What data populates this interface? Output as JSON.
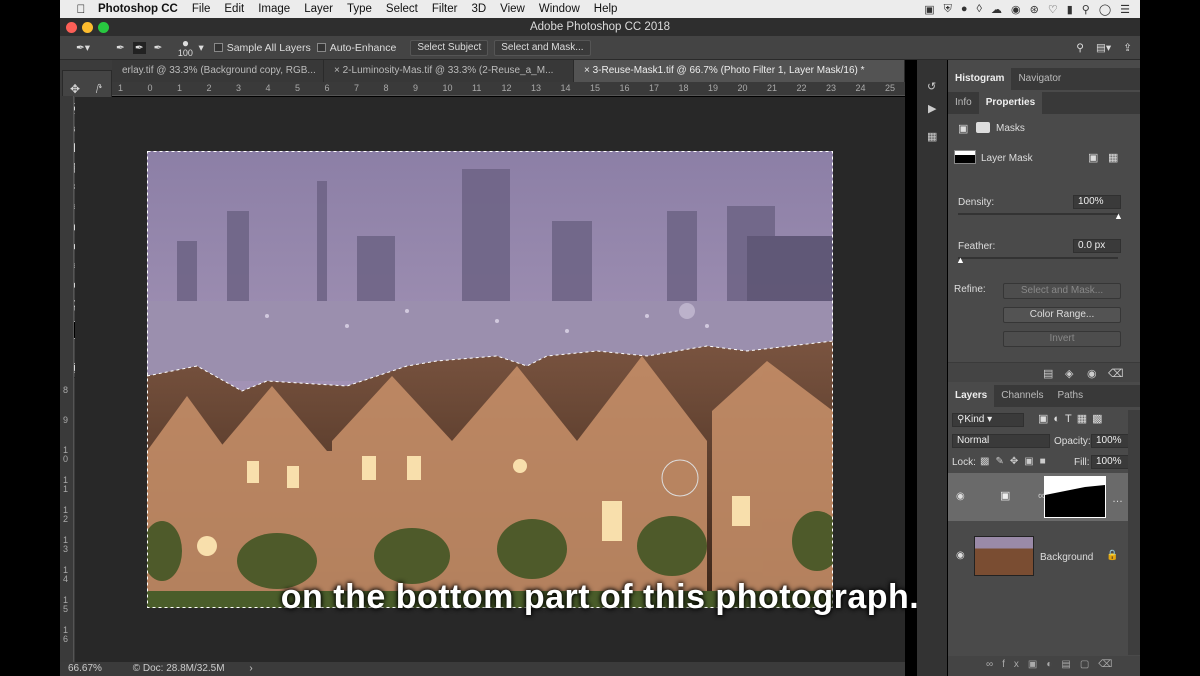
{
  "menubar": {
    "app": "Photoshop CC",
    "items": [
      "File",
      "Edit",
      "Image",
      "Layer",
      "Type",
      "Select",
      "Filter",
      "3D",
      "View",
      "Window",
      "Help"
    ]
  },
  "window": {
    "title": "Adobe Photoshop CC 2018"
  },
  "options": {
    "brush_size": "100",
    "sample_all_layers": "Sample All Layers",
    "auto_enhance": "Auto-Enhance",
    "select_subject": "Select Subject",
    "select_and_mask": "Select and Mask..."
  },
  "tabs": [
    {
      "label": "erlay.tif @ 33.3% (Background copy, RGB...",
      "close": "×"
    },
    {
      "label": "2-Luminosity-Mas.tif @ 33.3% (2-Reuse_a_M...",
      "close": "×"
    },
    {
      "label": "3-Reuse-Mask1.tif @ 66.7% (Photo Filter 1, Layer Mask/16) *",
      "close": "×"
    }
  ],
  "ruler": {
    "h": [
      "1",
      "0",
      "1",
      "2",
      "3",
      "4",
      "5",
      "6",
      "7",
      "8",
      "9",
      "10",
      "11",
      "12",
      "13",
      "14",
      "15",
      "16",
      "17",
      "18",
      "19",
      "20",
      "21",
      "22",
      "23",
      "24",
      "25"
    ],
    "v": [
      "8",
      "9",
      "1\n0",
      "1\n1",
      "1\n2",
      "1\n3",
      "1\n4",
      "1\n5",
      "1\n6"
    ]
  },
  "caption": "on the bottom part of this photograph.",
  "status": {
    "zoom": "66.67%",
    "doc": "Doc: 28.8M/32.5M"
  },
  "panels": {
    "top_tabs": [
      "Histogram",
      "Navigator"
    ],
    "mid_tabs": [
      "Info",
      "Properties"
    ],
    "masks_label": "Masks",
    "layer_mask_label": "Layer Mask",
    "density_label": "Density:",
    "density_value": "100%",
    "density_fraction": 1.0,
    "feather_label": "Feather:",
    "feather_value": "0.0 px",
    "feather_fraction": 0.0,
    "refine_label": "Refine:",
    "select_and_mask_btn": "Select and Mask...",
    "color_range_btn": "Color Range...",
    "invert_btn": "Invert"
  },
  "layers": {
    "tabs": [
      "Layers",
      "Channels",
      "Paths"
    ],
    "kind": "Kind",
    "blend_mode": "Normal",
    "opacity_label": "Opacity:",
    "opacity_value": "100%",
    "lock_label": "Lock:",
    "fill_label": "Fill:",
    "fill_value": "100%",
    "rows": [
      {
        "name": "",
        "type": "photo-filter-adjustment"
      },
      {
        "name": "Background",
        "type": "image"
      }
    ]
  }
}
